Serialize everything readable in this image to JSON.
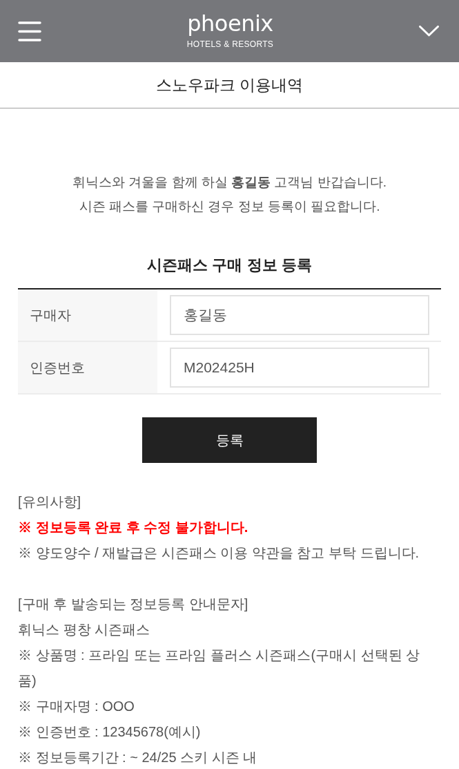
{
  "header": {
    "logo": {
      "wordmark": "phoenix",
      "tagline": "HOTELS & RESORTS"
    }
  },
  "page_title": "스노우파크 이용내역",
  "intro": [
    "휘닉스와 겨울을 함께 하실 **홍길동** 고객님 반갑습니다.",
    "시즌 패스를 구매하신 경우 정보 등록이 필요합니다."
  ],
  "form": {
    "title": "시즌패스 구매 정보 등록",
    "fields": [
      {
        "label": "구매자",
        "value": "홍길동"
      },
      {
        "label": "인증번호",
        "value": "M202425H"
      }
    ],
    "submit": "등록"
  },
  "notes": [
    {
      "heading": "[유의사항]",
      "lines": [
        {
          "kind": "warning",
          "text": "※ 정보등록 완료 후 수정 불가합니다."
        },
        {
          "kind": "text",
          "text": "※ 양도양수 / 재발급은 시즌패스 이용 약관을 참고 부탁 드립니다."
        }
      ]
    },
    {
      "heading": "[구매 후 발송되는 정보등록 안내문자]",
      "lines": [
        {
          "kind": "text",
          "text": "휘닉스 평창 시즌패스"
        },
        {
          "kind": "text",
          "text": "※ 상품명 : 프라임 또는 프라임 플러스 시즌패스(구매시 선택된 상품)"
        },
        {
          "kind": "text",
          "text": "※ 구매자명 : OOO"
        },
        {
          "kind": "text",
          "text": "※ 인증번호 : 12345678(예시)"
        },
        {
          "kind": "text",
          "text": "※ 정보등록기간 : ~ 24/25 스키 시즌 내"
        }
      ]
    }
  ]
}
